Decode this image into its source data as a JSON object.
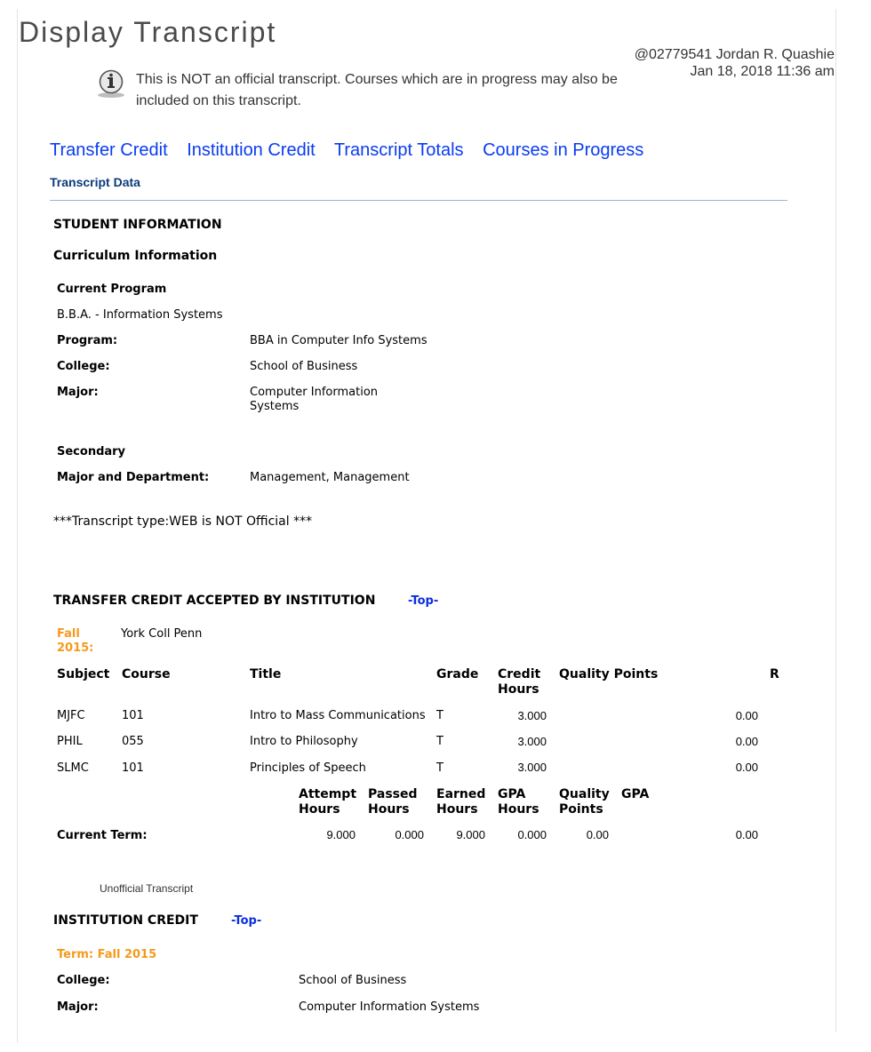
{
  "page": {
    "title": "Display Transcript",
    "user_line": "@02779541 Jordan R. Quashie",
    "datetime": "Jan 18, 2018 11:36 am",
    "notice": "This is NOT an official transcript. Courses which are in progress may also be included on this transcript."
  },
  "tabs": [
    "Transfer Credit",
    "Institution Credit",
    "Transcript Totals",
    "Courses in Progress"
  ],
  "section_label": "Transcript Data",
  "student": {
    "heading": "STUDENT INFORMATION",
    "curriculum_heading": "Curriculum Information",
    "current_program_label": "Current Program",
    "current_program": "B.B.A. - Information Systems",
    "program_label": "Program:",
    "program": "BBA in Computer Info Systems",
    "college_label": "College:",
    "college": "School of Business",
    "major_label": "Major:",
    "major_line1": "Computer Information",
    "major_line2": "Systems",
    "secondary_label": "Secondary",
    "major_dept_label": "Major and Department:",
    "major_dept": "Management, Management",
    "transcript_type": "***Transcript type:WEB is NOT Official ***"
  },
  "transfer": {
    "heading": "TRANSFER CREDIT ACCEPTED BY INSTITUTION",
    "top_link": "-Top-",
    "term_line1": "Fall",
    "term_line2": "2015:",
    "institution": "York Coll Penn",
    "headers": {
      "subject": "Subject",
      "course": "Course",
      "title": "Title",
      "grade": "Grade",
      "credit1": "Credit",
      "credit2": "Hours",
      "qp": "Quality Points",
      "r": "R"
    },
    "rows": [
      {
        "subject": "MJFC",
        "course": "101",
        "title": "Intro to Mass Communications",
        "grade": "T",
        "credit": "3.000",
        "qp": "0.00"
      },
      {
        "subject": "PHIL",
        "course": "055",
        "title": "Intro to Philosophy",
        "grade": "T",
        "credit": "3.000",
        "qp": "0.00"
      },
      {
        "subject": "SLMC",
        "course": "101",
        "title": "Principles of Speech",
        "grade": "T",
        "credit": "3.000",
        "qp": "0.00"
      }
    ],
    "totals_headers": {
      "attempt1": "Attempt",
      "attempt2": "Hours",
      "passed1": "Passed",
      "passed2": "Hours",
      "earned1": "Earned",
      "earned2": "Hours",
      "gpah1": "GPA",
      "gpah2": "Hours",
      "qp1": "Quality",
      "qp2": "Points",
      "gpa": "GPA"
    },
    "current_term_label": "Current Term:",
    "totals": {
      "attempt": "9.000",
      "passed": "0.000",
      "earned": "9.000",
      "gpa_hours": "0.000",
      "quality_points": "0.00",
      "gpa": "0.00"
    }
  },
  "unofficial_label": "Unofficial Transcript",
  "institution": {
    "heading": "INSTITUTION CREDIT",
    "top_link": "-Top-",
    "term": "Term: Fall 2015",
    "college_label": "College:",
    "college": "School of Business",
    "major_label": "Major:",
    "major": "Computer Information Systems"
  }
}
